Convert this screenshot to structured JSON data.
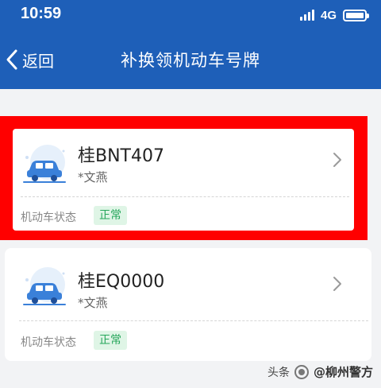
{
  "status_bar": {
    "time": "10:59",
    "network": "4G"
  },
  "nav": {
    "back_label": "返回",
    "title": "补换领机动车号牌"
  },
  "vehicles": [
    {
      "plate": "桂BNT407",
      "owner": "*文燕",
      "status_label": "机动车状态",
      "status_value": "正常",
      "selected": true
    },
    {
      "plate": "桂EQ0000",
      "owner": "*文燕",
      "status_label": "机动车状态",
      "status_value": "正常",
      "selected": false
    }
  ],
  "watermark": {
    "source": "头条",
    "account": "@柳州警方"
  },
  "colors": {
    "header": "#1e5fb8",
    "highlight": "#ff0000",
    "status_badge_bg": "#dff5e6",
    "status_badge_text": "#26a65b",
    "car_icon": "#3a80d9"
  },
  "icons": {
    "back": "chevron-left-icon",
    "car": "car-icon",
    "arrow": "chevron-right-icon"
  }
}
